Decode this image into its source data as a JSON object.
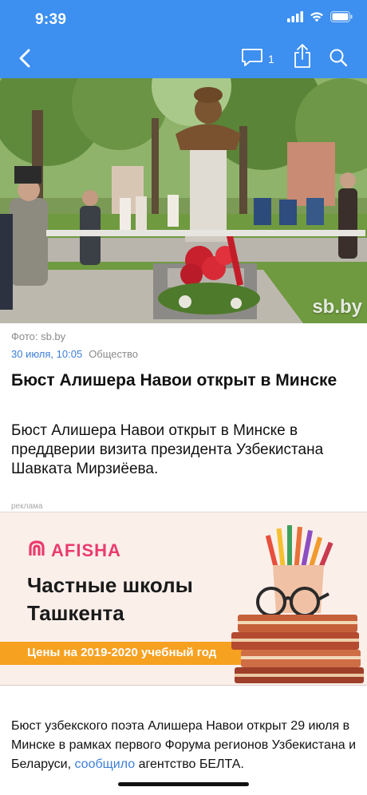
{
  "status_bar": {
    "time": "9:39"
  },
  "nav": {
    "comment_count": "1",
    "icons": [
      "back-chevron-icon",
      "comment-icon",
      "share-icon",
      "search-icon"
    ]
  },
  "hero": {
    "watermark": "sb.by"
  },
  "article": {
    "photo_credit": "Фото: sb.by",
    "date": "30 июля, 10:05",
    "category": "Общество",
    "title": "Бюст Алишера Навои открыт в Минске",
    "lead": "Бюст Алишера Навои открыт в Минске в преддверии визита президента Узбекистана Шавката Мирзиёева.",
    "body_text": "Бюст узбекского поэта Алишера Навои открыт 29 июля в Минске в рамках первого Форума регионов Узбекистана и Беларуси,",
    "body_link": "сообщило",
    "body_tail": "агентство БЕЛТА."
  },
  "ad": {
    "label": "реклама",
    "brand": "AFISHA",
    "headline": "Частные школы Ташкента",
    "strip": "Цены на 2019-2020 учебный год"
  },
  "colors": {
    "header": "#3d8ff0",
    "link": "#3d7fd9",
    "brand_pink": "#ea3b6d",
    "strip_orange": "#f7a121"
  }
}
